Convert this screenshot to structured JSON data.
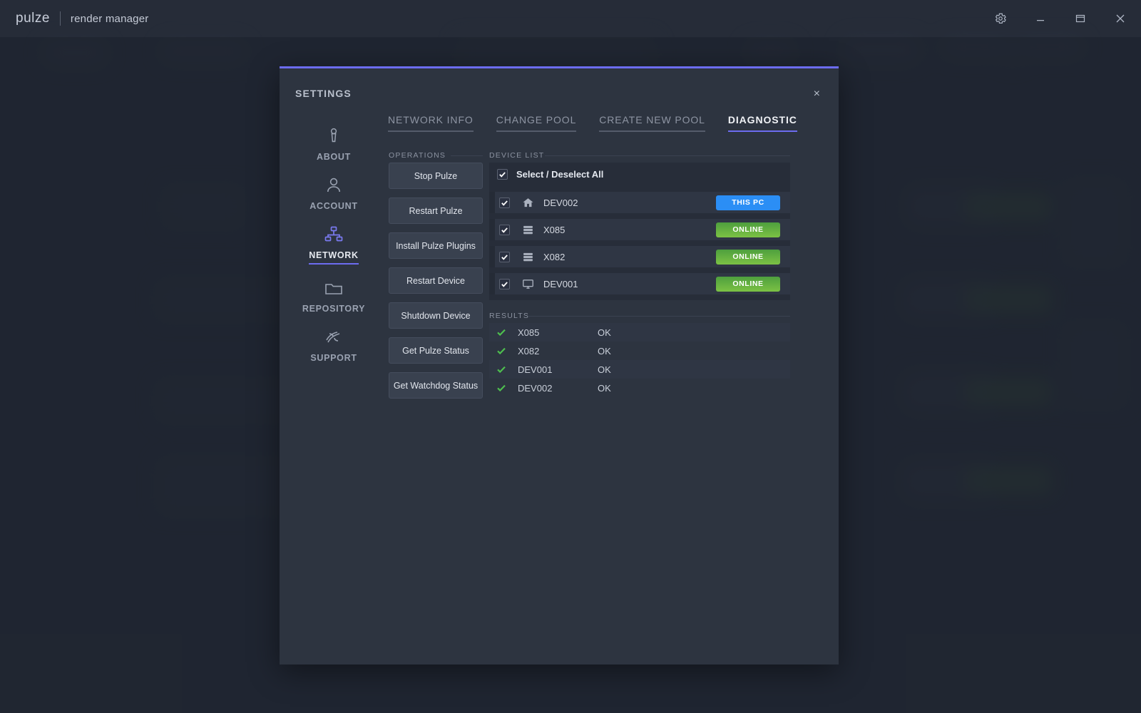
{
  "titlebar": {
    "brand": "pulze",
    "product": "render manager",
    "controls": [
      {
        "name": "settings-gear-button",
        "icon": "gear-icon"
      },
      {
        "name": "minimize-button",
        "icon": "minimize-icon"
      },
      {
        "name": "restore-button",
        "icon": "restore-icon"
      },
      {
        "name": "close-button",
        "icon": "close-icon"
      }
    ]
  },
  "dialog": {
    "title": "SETTINGS",
    "close_label": "×"
  },
  "sidebar": {
    "items": [
      {
        "label": "ABOUT",
        "icon": "info-icon",
        "active": false
      },
      {
        "label": "ACCOUNT",
        "icon": "user-icon",
        "active": false
      },
      {
        "label": "NETWORK",
        "icon": "network-tree-icon",
        "active": true
      },
      {
        "label": "REPOSITORY",
        "icon": "folder-icon",
        "active": false
      },
      {
        "label": "SUPPORT",
        "icon": "support-icon",
        "active": false
      }
    ]
  },
  "tabs": [
    {
      "label": "NETWORK INFO",
      "active": false
    },
    {
      "label": "CHANGE POOL",
      "active": false
    },
    {
      "label": "CREATE NEW POOL",
      "active": false
    },
    {
      "label": "DIAGNOSTIC",
      "active": true
    }
  ],
  "operations": {
    "section_label": "OPERATIONS",
    "buttons": [
      "Stop Pulze",
      "Restart Pulze",
      "Install Pulze Plugins",
      "Restart Device",
      "Shutdown Device",
      "Get Pulze Status",
      "Get Watchdog Status"
    ]
  },
  "device_list": {
    "section_label": "DEVICE LIST",
    "select_all_label": "Select / Deselect All",
    "select_all_checked": true,
    "devices": [
      {
        "name": "DEV002",
        "icon": "home-icon",
        "checked": true,
        "badge": "THIS PC",
        "badge_color": "#2b8ef5"
      },
      {
        "name": "X085",
        "icon": "server-icon",
        "checked": true,
        "badge": "ONLINE",
        "badge_color": "#62b141"
      },
      {
        "name": "X082",
        "icon": "server-icon",
        "checked": true,
        "badge": "ONLINE",
        "badge_color": "#62b141"
      },
      {
        "name": "DEV001",
        "icon": "monitor-icon",
        "checked": true,
        "badge": "ONLINE",
        "badge_color": "#62b141"
      }
    ]
  },
  "results": {
    "section_label": "RESULTS",
    "rows": [
      {
        "name": "X085",
        "status": "OK",
        "icon": "check-icon"
      },
      {
        "name": "X082",
        "status": "OK",
        "icon": "check-icon"
      },
      {
        "name": "DEV001",
        "status": "OK",
        "icon": "check-icon"
      },
      {
        "name": "DEV002",
        "status": "OK",
        "icon": "check-icon"
      }
    ]
  },
  "colors": {
    "accent": "#6c6cf0",
    "online": "#62b141",
    "this_pc": "#2b8ef5",
    "check": "#4ec04e",
    "dialog_bg": "#2d3440",
    "app_bg": "#232935"
  }
}
